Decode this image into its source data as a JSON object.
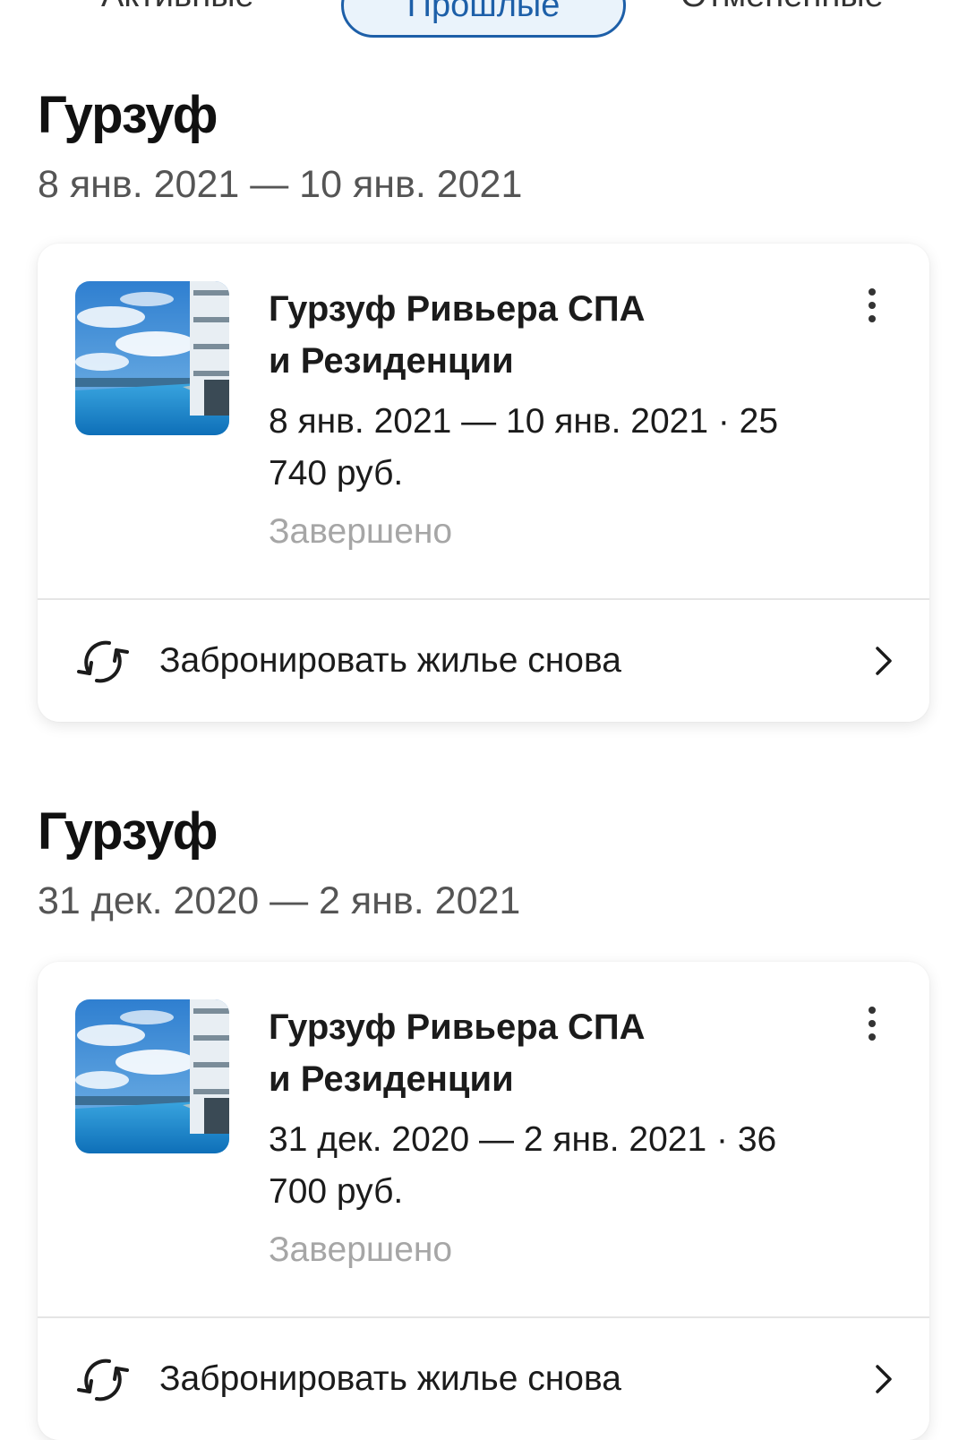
{
  "tabs": {
    "left_label": "Активные",
    "active_label": "Прошлые",
    "right_label": "Отменённые"
  },
  "trips": [
    {
      "city": "Гурзуф",
      "dates": "8 янв. 2021 — 10 янв. 2021",
      "hotel_name": "Гурзуф Ривьера СПА и Резиденции",
      "booking_info": "8 янв. 2021 — 10 янв. 2021 · 25 740 руб.",
      "status": "Завершено",
      "rebook_label": "Забронировать жилье снова",
      "thumb_icon": "hotel-photo",
      "more_icon": "more-vertical-icon"
    },
    {
      "city": "Гурзуф",
      "dates": "31 дек. 2020 — 2 янв. 2021",
      "hotel_name": "Гурзуф Ривьера СПА и Резиденции",
      "booking_info": "31 дек. 2020 — 2 янв. 2021 · 36 700 руб.",
      "status": "Завершено",
      "rebook_label": "Забронировать жилье снова",
      "thumb_icon": "hotel-photo",
      "more_icon": "more-vertical-icon"
    }
  ],
  "colors": {
    "accent": "#1d5fa8",
    "status_gray": "#a6a6a6",
    "text_dark": "#1b1b1b"
  }
}
